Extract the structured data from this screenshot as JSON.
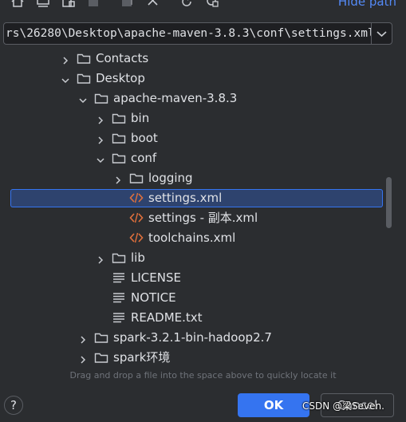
{
  "toolbar": {
    "icons": [
      "home-icon",
      "desktop-icon",
      "project-icon",
      "module-icon",
      "new-folder-icon",
      "delete-icon",
      "refresh-icon",
      "show-hidden-icon"
    ],
    "hide_path_label": "Hide path"
  },
  "path_bar": {
    "value": "rs\\26280\\Desktop\\apache-maven-3.8.3\\conf\\settings.xml"
  },
  "tree": {
    "rows": [
      {
        "label": "Contacts",
        "type": "folder",
        "expanded": false,
        "selected": false
      },
      {
        "label": "Desktop",
        "type": "folder",
        "expanded": true,
        "selected": false
      },
      {
        "label": "apache-maven-3.8.3",
        "type": "folder",
        "expanded": true,
        "selected": false
      },
      {
        "label": "bin",
        "type": "folder",
        "expanded": false,
        "selected": false
      },
      {
        "label": "boot",
        "type": "folder",
        "expanded": false,
        "selected": false
      },
      {
        "label": "conf",
        "type": "folder",
        "expanded": true,
        "selected": false
      },
      {
        "label": "logging",
        "type": "folder",
        "expanded": false,
        "selected": false
      },
      {
        "label": "settings.xml",
        "type": "xml",
        "expanded": null,
        "selected": true
      },
      {
        "label": "settings - 副本.xml",
        "type": "xml",
        "expanded": null,
        "selected": false
      },
      {
        "label": "toolchains.xml",
        "type": "xml",
        "expanded": null,
        "selected": false
      },
      {
        "label": "lib",
        "type": "folder",
        "expanded": false,
        "selected": false
      },
      {
        "label": "LICENSE",
        "type": "text",
        "expanded": null,
        "selected": false
      },
      {
        "label": "NOTICE",
        "type": "text",
        "expanded": null,
        "selected": false
      },
      {
        "label": "README.txt",
        "type": "text",
        "expanded": null,
        "selected": false
      },
      {
        "label": "spark-3.2.1-bin-hadoop2.7",
        "type": "folder",
        "expanded": false,
        "selected": false
      },
      {
        "label": "spark环境",
        "type": "folder",
        "expanded": false,
        "selected": false
      }
    ]
  },
  "hint_text": "Drag and drop a file into the space above to quickly locate it",
  "buttons": {
    "help_label": "?",
    "ok_label": "OK",
    "cancel_label": "Cancel"
  },
  "watermark_text": "CSDN @梁Seven.",
  "colors": {
    "accent": "#3574f0",
    "link": "#548af7",
    "selection": "#2e436e",
    "xml_icon": "#e0703c"
  }
}
